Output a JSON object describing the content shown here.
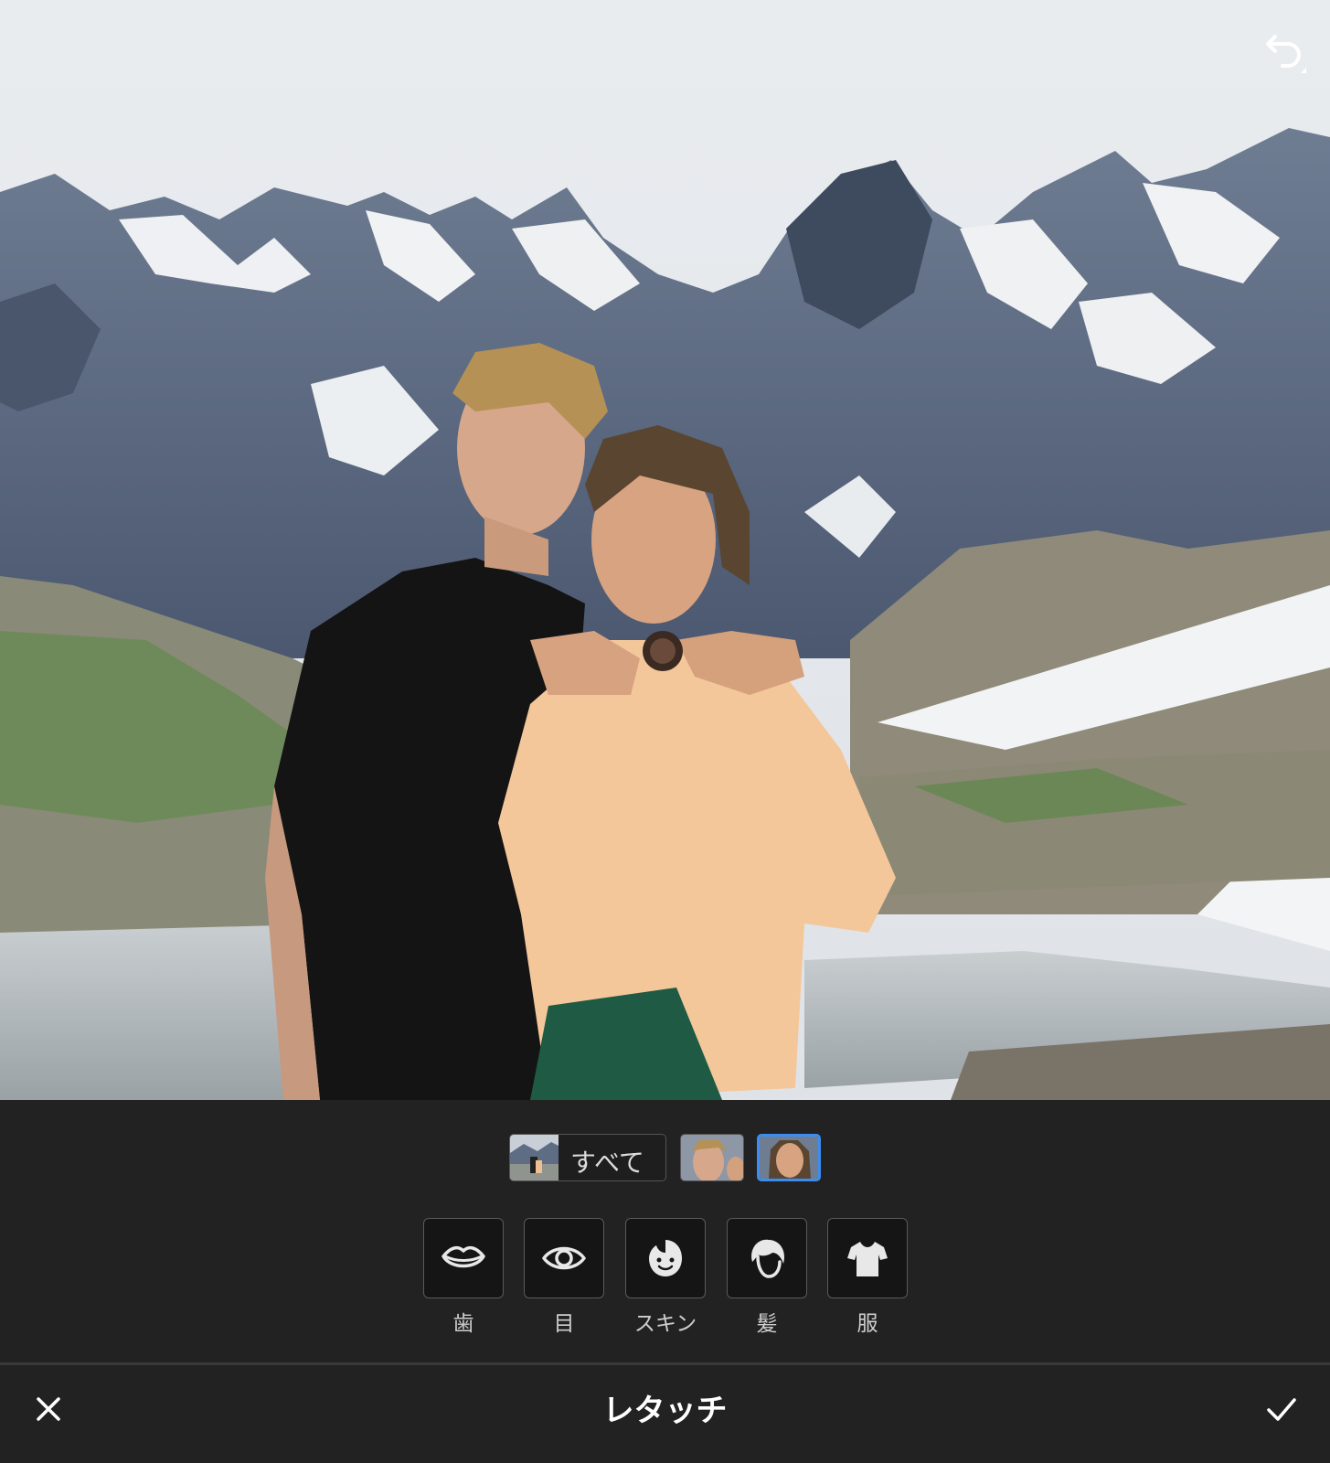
{
  "editor": {
    "title": "レタッチ",
    "icons": {
      "undo": "undo-icon",
      "close": "close-icon",
      "confirm": "check-icon"
    }
  },
  "face_selector": {
    "all_label": "すべて",
    "faces": [
      {
        "name": "face-man",
        "selected": false
      },
      {
        "name": "face-woman",
        "selected": true
      }
    ],
    "accent_color": "#3b8df0"
  },
  "tools": [
    {
      "label": "歯",
      "icon": "lips-icon"
    },
    {
      "label": "目",
      "icon": "eye-icon"
    },
    {
      "label": "スキン",
      "icon": "face-skin-icon"
    },
    {
      "label": "髪",
      "icon": "hair-icon"
    },
    {
      "label": "服",
      "icon": "shirt-icon"
    }
  ]
}
